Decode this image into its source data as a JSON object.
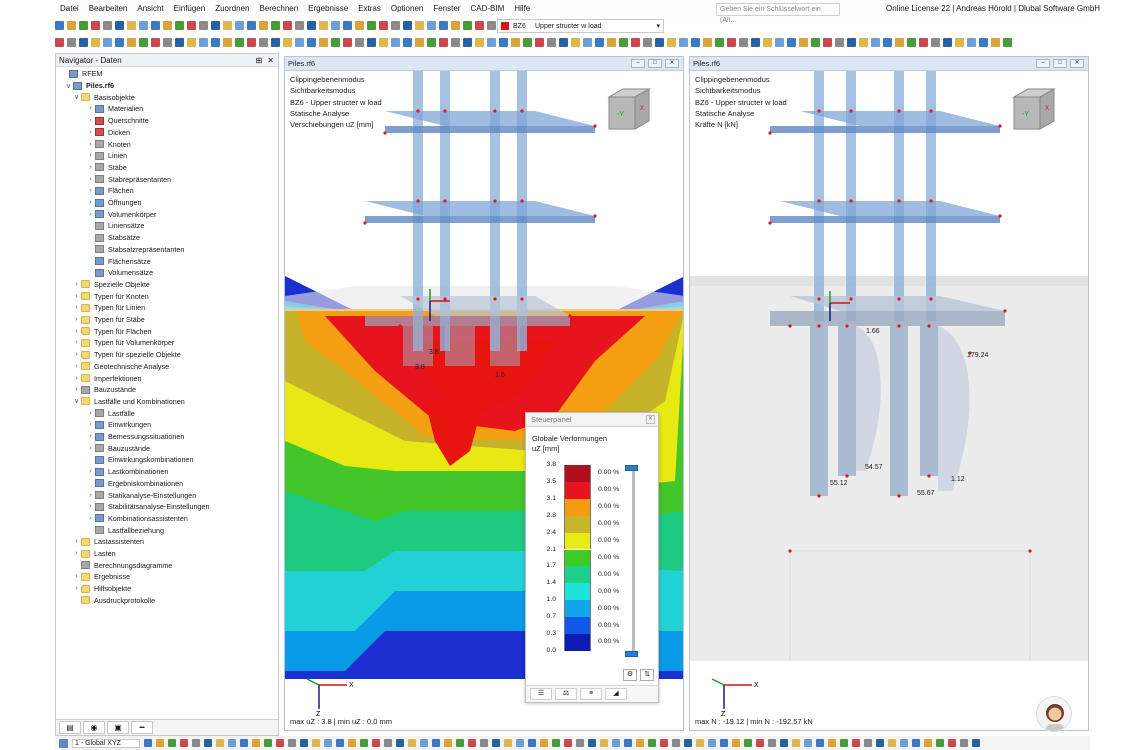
{
  "menu": [
    "Datei",
    "Bearbeiten",
    "Ansicht",
    "Einfügen",
    "Zuordnen",
    "Berechnen",
    "Ergebnisse",
    "Extras",
    "Optionen",
    "Fenster",
    "CAD-BIM",
    "Hilfe"
  ],
  "search_placeholder": "Geben Sie ein Schlüsselwort ein (Alt...",
  "license": "Online License 22 | Andreas Hörold | Dlubal Software GmbH",
  "loadcase": {
    "id": "BZ6",
    "name": "Upper structer w load",
    "color": "#d9141b"
  },
  "navigator": {
    "title": "Navigator - Daten",
    "root": "RFEM",
    "file": "Piles.rf6",
    "items": [
      {
        "label": "Basisobjekte",
        "level": 1,
        "icon": "folder",
        "arrow": "open"
      },
      {
        "label": "Materialien",
        "level": 2,
        "icon": "obj",
        "arrow": "closed"
      },
      {
        "label": "Querschnitte",
        "level": 2,
        "icon": "red",
        "arrow": "closed"
      },
      {
        "label": "Dicken",
        "level": 2,
        "icon": "red",
        "arrow": "closed"
      },
      {
        "label": "Knoten",
        "level": 2,
        "icon": "dot",
        "arrow": "closed"
      },
      {
        "label": "Linien",
        "level": 2,
        "icon": "line",
        "arrow": "closed"
      },
      {
        "label": "Stäbe",
        "level": 2,
        "icon": "line",
        "arrow": "closed"
      },
      {
        "label": "Stabrepräsentanten",
        "level": 2,
        "icon": "line",
        "arrow": "closed"
      },
      {
        "label": "Flächen",
        "level": 2,
        "icon": "obj",
        "arrow": "closed"
      },
      {
        "label": "Öffnungen",
        "level": 2,
        "icon": "obj",
        "arrow": "closed"
      },
      {
        "label": "Volumenkörper",
        "level": 2,
        "icon": "obj",
        "arrow": "closed"
      },
      {
        "label": "Liniensätze",
        "level": 2,
        "icon": "line",
        "arrow": ""
      },
      {
        "label": "Stabsätze",
        "level": 2,
        "icon": "line",
        "arrow": ""
      },
      {
        "label": "Stabsatzrepräsentanten",
        "level": 2,
        "icon": "line",
        "arrow": ""
      },
      {
        "label": "Flächensätze",
        "level": 2,
        "icon": "obj",
        "arrow": ""
      },
      {
        "label": "Volumensätze",
        "level": 2,
        "icon": "obj",
        "arrow": ""
      },
      {
        "label": "Spezielle Objekte",
        "level": 1,
        "icon": "folder",
        "arrow": "closed"
      },
      {
        "label": "Typen für Knoten",
        "level": 1,
        "icon": "folder",
        "arrow": "closed"
      },
      {
        "label": "Typen für Linien",
        "level": 1,
        "icon": "folder",
        "arrow": "closed"
      },
      {
        "label": "Typen für Stäbe",
        "level": 1,
        "icon": "folder",
        "arrow": "closed"
      },
      {
        "label": "Typen für Flächen",
        "level": 1,
        "icon": "folder",
        "arrow": "closed"
      },
      {
        "label": "Typen für Volumenkörper",
        "level": 1,
        "icon": "folder",
        "arrow": "closed"
      },
      {
        "label": "Typen für spezielle Objekte",
        "level": 1,
        "icon": "folder",
        "arrow": "closed"
      },
      {
        "label": "Geotechnische Analyse",
        "level": 1,
        "icon": "folder",
        "arrow": "closed"
      },
      {
        "label": "Imperfektionen",
        "level": 1,
        "icon": "folder",
        "arrow": "closed"
      },
      {
        "label": "Bauzustände",
        "level": 1,
        "icon": "grey",
        "arrow": "closed"
      },
      {
        "label": "Lastfälle und Kombinationen",
        "level": 1,
        "icon": "folder",
        "arrow": "open"
      },
      {
        "label": "Lastfälle",
        "level": 2,
        "icon": "line",
        "arrow": "closed"
      },
      {
        "label": "Einwirkungen",
        "level": 2,
        "icon": "obj",
        "arrow": "closed"
      },
      {
        "label": "Bemessungssituationen",
        "level": 2,
        "icon": "obj",
        "arrow": "closed"
      },
      {
        "label": "Bauzustände",
        "level": 2,
        "icon": "grey",
        "arrow": "closed"
      },
      {
        "label": "Einwirkungskombinationen",
        "level": 2,
        "icon": "obj",
        "arrow": ""
      },
      {
        "label": "Lastkombinationen",
        "level": 2,
        "icon": "obj",
        "arrow": "closed"
      },
      {
        "label": "Ergebniskombinationen",
        "level": 2,
        "icon": "obj",
        "arrow": ""
      },
      {
        "label": "Statikanalyse-Einstellungen",
        "level": 2,
        "icon": "line",
        "arrow": "closed"
      },
      {
        "label": "Stabilitätsanalyse-Einstellungen",
        "level": 2,
        "icon": "line",
        "arrow": "closed"
      },
      {
        "label": "Kombinationsassistenten",
        "level": 2,
        "icon": "obj",
        "arrow": "closed"
      },
      {
        "label": "Lastfallbeziehung",
        "level": 2,
        "icon": "grey",
        "arrow": ""
      },
      {
        "label": "Lastassistenten",
        "level": 1,
        "icon": "folder",
        "arrow": "closed"
      },
      {
        "label": "Lasten",
        "level": 1,
        "icon": "folder",
        "arrow": "closed"
      },
      {
        "label": "Berechnungsdiagramme",
        "level": 1,
        "icon": "line",
        "arrow": ""
      },
      {
        "label": "Ergebnisse",
        "level": 1,
        "icon": "folder",
        "arrow": "closed"
      },
      {
        "label": "Hilfsobjekte",
        "level": 1,
        "icon": "folder",
        "arrow": "closed"
      },
      {
        "label": "Ausdruckprotokolle",
        "level": 1,
        "icon": "folder",
        "arrow": ""
      }
    ]
  },
  "view_left": {
    "title": "Piles.rf6",
    "info": [
      "Clippingebenenmodus",
      "Sichtbarkeitsmodus",
      "BZ6 - Upper structer w load",
      "Statische Analyse",
      "Verschiebungen uZ [mm]"
    ],
    "footer": "max uZ : 3.8 | min uZ : 0.0 mm",
    "labels": [
      "3.8",
      "1.6",
      "3.8"
    ]
  },
  "view_right": {
    "title": "Piles.rf6",
    "info": [
      "Clippingebenenmodus",
      "Sichtbarkeitsmodus",
      "BZ6 - Upper structer w load",
      "Statische Analyse",
      "Kräfte N [kN]"
    ],
    "footer": "max N : -19.12 | min N : -192.57 kN",
    "labels": [
      "179.24",
      "54.57",
      "55.12",
      "55.67",
      "1.12",
      "1.66"
    ]
  },
  "control_panel": {
    "title": "Steuerpanel",
    "subtitle": "Globale Verformungen",
    "unit": "uZ [mm]",
    "legend": [
      {
        "value": "3.8",
        "color": "#b0101c",
        "pct": "0.00 %"
      },
      {
        "value": "3.5",
        "color": "#e6141e",
        "pct": "0.00 %"
      },
      {
        "value": "3.1",
        "color": "#f59a12",
        "pct": "0.00 %"
      },
      {
        "value": "2.8",
        "color": "#c8b52a",
        "pct": "0.00 %"
      },
      {
        "value": "2.4",
        "color": "#eaea14",
        "pct": "0.00 %"
      },
      {
        "value": "2.1",
        "color": "#3ccc28",
        "pct": "0.00 %"
      },
      {
        "value": "1.7",
        "color": "#1fd08a",
        "pct": "0.00 %"
      },
      {
        "value": "1.4",
        "color": "#1ee3d8",
        "pct": "0.00 %"
      },
      {
        "value": "1.0",
        "color": "#12a6ea",
        "pct": "0.00 %"
      },
      {
        "value": "0.7",
        "color": "#1257e8",
        "pct": "0.00 %"
      },
      {
        "value": "0.3",
        "color": "#0a1cb4",
        "pct": "0.00 %"
      },
      {
        "value": "0.0",
        "color": "",
        "pct": ""
      }
    ]
  },
  "status": {
    "coord_system": "1 - Global XYZ"
  },
  "axes": {
    "x": "X",
    "y": "Y",
    "z": "Z"
  }
}
